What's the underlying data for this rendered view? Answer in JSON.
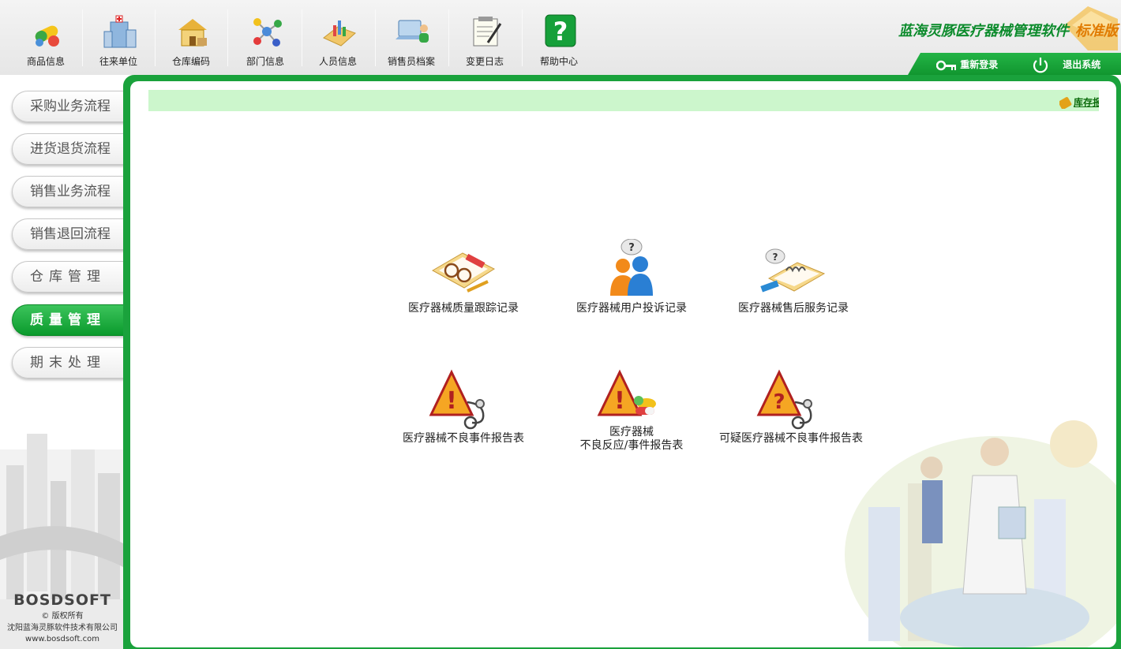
{
  "toolbar": {
    "items": [
      {
        "label": "商品信息",
        "icon": "product-pills-icon"
      },
      {
        "label": "往来单位",
        "icon": "hospital-building-icon"
      },
      {
        "label": "仓库编码",
        "icon": "warehouse-house-icon"
      },
      {
        "label": "部门信息",
        "icon": "department-molecule-icon"
      },
      {
        "label": "人员信息",
        "icon": "personnel-chart-icon"
      },
      {
        "label": "销售员档案",
        "icon": "salesman-laptop-icon"
      },
      {
        "label": "变更日志",
        "icon": "change-log-notepad-icon"
      },
      {
        "label": "帮助中心",
        "icon": "help-question-icon"
      }
    ]
  },
  "brand": {
    "title": "蓝海灵豚医疗器械管理软件",
    "edition": "标准版"
  },
  "session": {
    "relogin": "重新登录",
    "exit": "退出系统"
  },
  "sidebar": {
    "items": [
      {
        "label": "采购业务流程",
        "active": false
      },
      {
        "label": "进货退货流程",
        "active": false
      },
      {
        "label": "销售业务流程",
        "active": false
      },
      {
        "label": "销售退回流程",
        "active": false
      },
      {
        "label": "仓库管理",
        "active": false
      },
      {
        "label": "质量管理",
        "active": true
      },
      {
        "label": "期末处理",
        "active": false
      }
    ],
    "footer": {
      "logo": "BOSDSOFT",
      "copyright": "© 版权所有",
      "company": "沈阳蓝海灵豚软件技术有限公司",
      "website": "www.bosdsoft.com"
    }
  },
  "notice": {
    "link": "库存报警"
  },
  "tiles": [
    {
      "label": "医疗器械质量跟踪记录",
      "icon": "quality-tracking-icon"
    },
    {
      "label": "医疗器械用户投诉记录",
      "icon": "user-complaint-icon"
    },
    {
      "label": "医疗器械售后服务记录",
      "icon": "after-sales-icon"
    },
    {
      "label": "医疗器械不良事件报告表",
      "icon": "adverse-event-warning-icon"
    },
    {
      "label1": "医疗器械",
      "label2": "不良反应/事件报告表",
      "icon": "adverse-reaction-warning-icon"
    },
    {
      "label": "可疑医疗器械不良事件报告表",
      "icon": "suspicious-event-warning-icon"
    }
  ],
  "colors": {
    "accent": "#1aa23c",
    "notice_bg": "#ccf6cc",
    "brand": "#0c8b2c",
    "edition": "#e07a00"
  }
}
